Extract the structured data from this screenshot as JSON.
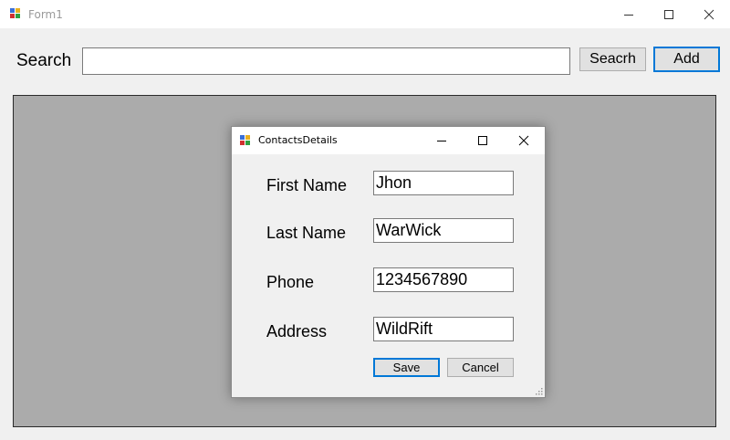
{
  "window": {
    "title": "Form1",
    "icon": "winforms-app-icon",
    "controls": {
      "minimize": "minimize-icon",
      "maximize": "maximize-icon",
      "close": "close-icon"
    }
  },
  "toolbar": {
    "search_label": "Search",
    "search_value": "",
    "search_button_label": "Seacrh",
    "add_button_label": "Add"
  },
  "dialog": {
    "title": "ContactsDetails",
    "icon": "winforms-app-icon",
    "fields": {
      "first_name": {
        "label": "First Name",
        "value": "Jhon"
      },
      "last_name": {
        "label": "Last Name",
        "value": "WarWick"
      },
      "phone": {
        "label": "Phone",
        "value": "1234567890"
      },
      "address": {
        "label": "Address",
        "value": "WildRift"
      }
    },
    "save_label": "Save",
    "cancel_label": "Cancel"
  },
  "colors": {
    "mdi_background": "#ababab",
    "focus_border": "#0078d7",
    "button_face": "#e1e1e1"
  }
}
